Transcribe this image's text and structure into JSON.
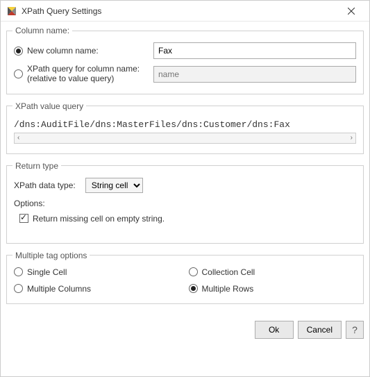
{
  "window": {
    "title": "XPath Query Settings"
  },
  "column_name": {
    "legend": "Column name:",
    "new_label": "New column name:",
    "new_value": "Fax",
    "xpath_label_line1": "XPath query for column name:",
    "xpath_label_line2": "(relative to value query)",
    "xpath_placeholder": "name",
    "selected": "new"
  },
  "value_query": {
    "legend": "XPath value query",
    "text": "/dns:AuditFile/dns:MasterFiles/dns:Customer/dns:Fax"
  },
  "return_type": {
    "legend": "Return type",
    "data_type_label": "XPath data type:",
    "data_type_value": "String cell",
    "options_label": "Options:",
    "opt_missing_label": "Return missing cell on empty string.",
    "opt_missing_checked": true
  },
  "multiple": {
    "legend": "Multiple tag options",
    "single": "Single Cell",
    "collection": "Collection Cell",
    "columns": "Multiple Columns",
    "rows": "Multiple Rows",
    "selected": "rows"
  },
  "buttons": {
    "ok": "Ok",
    "cancel": "Cancel",
    "help": "?"
  }
}
